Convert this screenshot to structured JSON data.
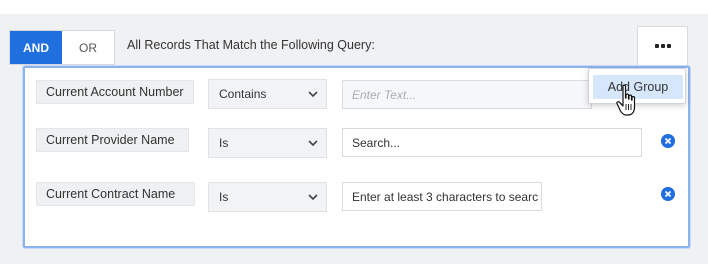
{
  "logic": {
    "and_label": "AND",
    "or_label": "OR",
    "active": "AND"
  },
  "query_title": "All Records That Match the Following Query:",
  "more_menu": {
    "icon": "ellipsis-icon",
    "items": [
      {
        "label": "Add Group"
      }
    ]
  },
  "rows": [
    {
      "label": "Current Account Number",
      "operator": "Contains",
      "value": "",
      "placeholder": "Enter Text...",
      "removable": false
    },
    {
      "label": "Current Provider Name",
      "operator": "Is",
      "value": "",
      "placeholder": "Search...",
      "removable": true
    },
    {
      "label": "Current Contract Name",
      "operator": "Is",
      "value": "",
      "placeholder": "Enter at least 3 characters to searc",
      "removable": true
    }
  ],
  "colors": {
    "accent": "#1f6fde",
    "panel_border": "#8ab4f0",
    "menu_highlight": "#d6e6fb",
    "background": "#f0f1f3"
  }
}
